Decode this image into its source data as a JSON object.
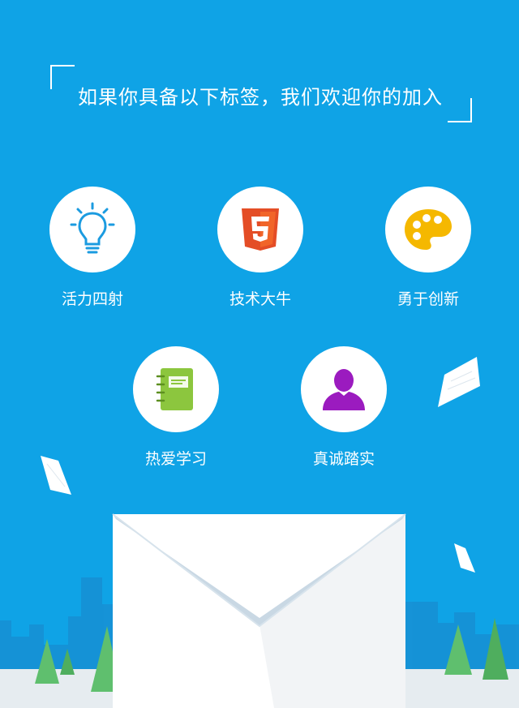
{
  "headline": "如果你具备以下标签，我们欢迎你的加入",
  "tags_row1": [
    {
      "label": "活力四射",
      "icon": "lightbulb-icon"
    },
    {
      "label": "技术大牛",
      "icon": "html5-icon"
    },
    {
      "label": "勇于创新",
      "icon": "palette-icon"
    }
  ],
  "tags_row2": [
    {
      "label": "热爱学习",
      "icon": "notebook-icon"
    },
    {
      "label": "真诚踏实",
      "icon": "person-icon"
    }
  ],
  "colors": {
    "background": "#0fa3e6",
    "lightbulb": "#1b9be0",
    "html5": "#e44d26",
    "palette": "#f5b800",
    "notebook": "#8cc63e",
    "person": "#9b1bbf",
    "tree": "#5fbf6e",
    "ground": "#e6ecf0"
  }
}
